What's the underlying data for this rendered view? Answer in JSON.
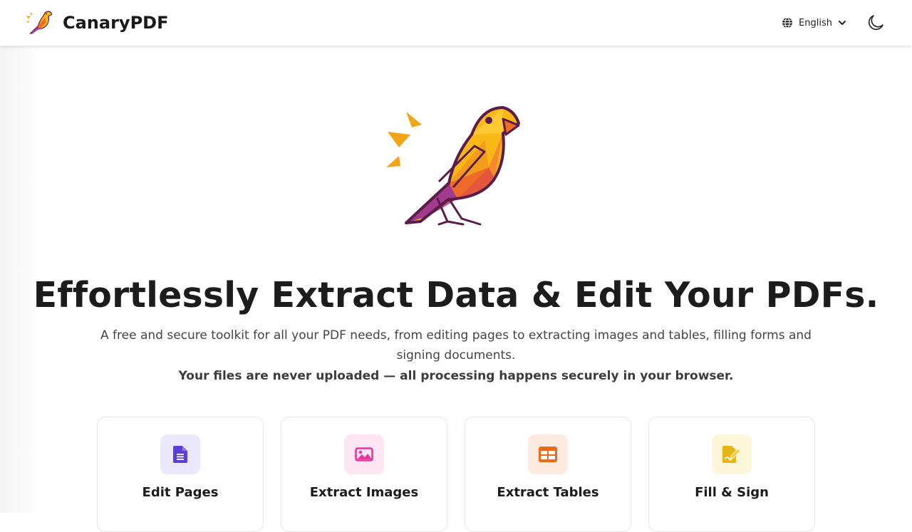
{
  "header": {
    "brand_name": "CanaryPDF",
    "language": "English",
    "icons": [
      "canary-logo",
      "globe-icon",
      "chevron-down-icon",
      "moon-icon"
    ]
  },
  "hero": {
    "headline": "Effortlessly Extract Data & Edit Your PDFs.",
    "subtitle": "A free and secure toolkit for all your PDF needs, from editing pages to extracting images and tables, filling forms and signing documents.",
    "secure_note": "Your files are never uploaded — all processing happens securely in your browser."
  },
  "tools": [
    {
      "label": "Edit Pages",
      "icon": "document-icon",
      "color": "#5b3fd6",
      "bg": "#ece8fb"
    },
    {
      "label": "Extract Images",
      "icon": "image-icon",
      "color": "#e0399a",
      "bg": "#fde6f2"
    },
    {
      "label": "Extract Tables",
      "icon": "table-icon",
      "color": "#ec6a18",
      "bg": "#fdebdf"
    },
    {
      "label": "Fill & Sign",
      "icon": "signature-icon",
      "color": "#e5b417",
      "bg": "#fdf6d9"
    }
  ],
  "colors": {
    "brand_text": "#1a1a1a",
    "bird_outline": "#5a1d4a",
    "bird_yellow": "#f7b500",
    "bird_orange": "#ef6b2a",
    "bird_purple": "#a23a8e"
  }
}
